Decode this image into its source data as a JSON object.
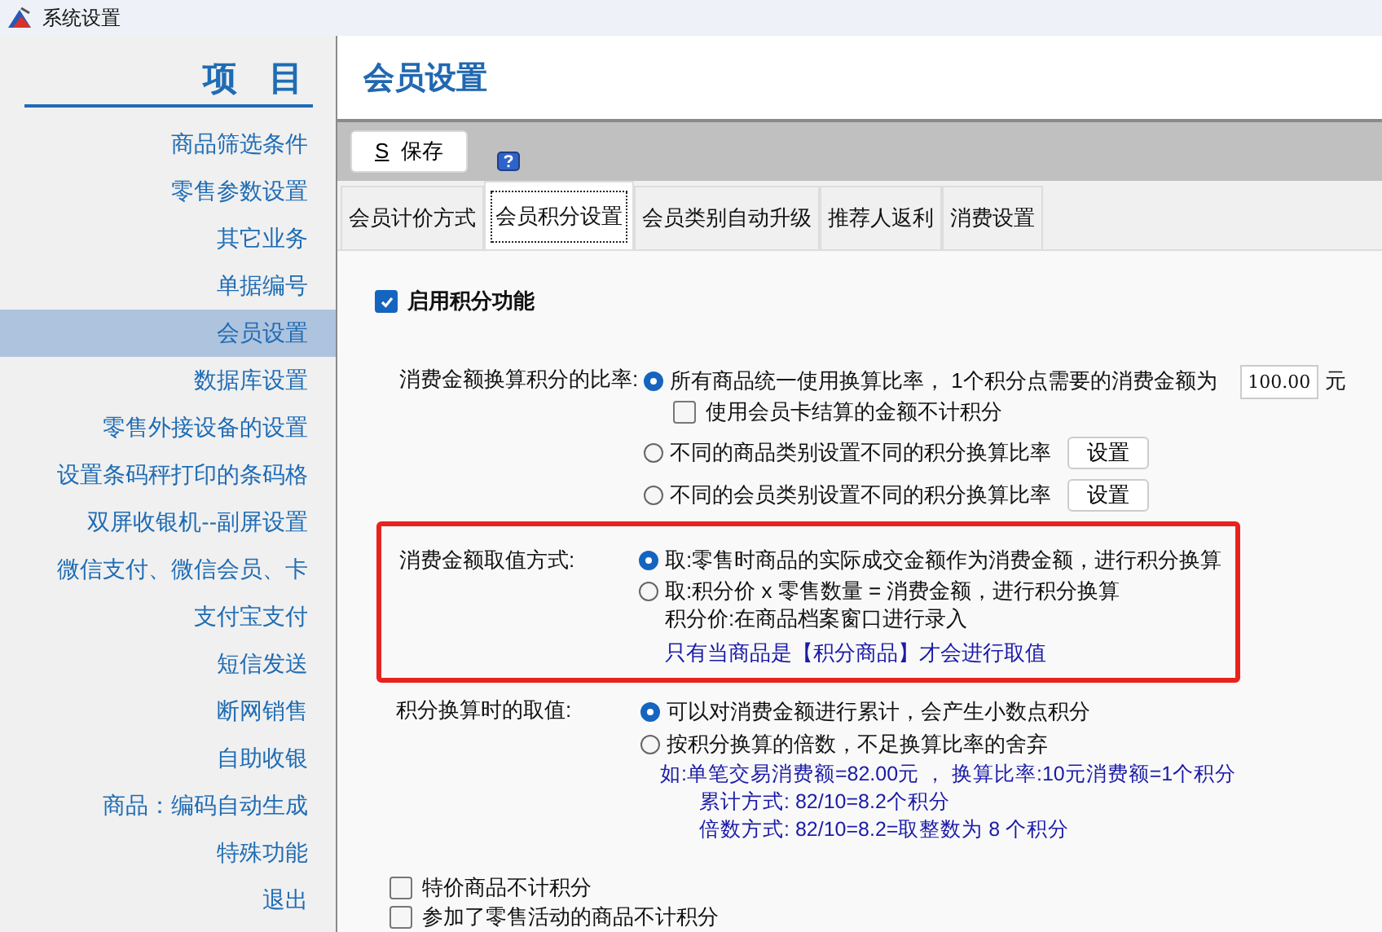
{
  "window": {
    "title": "系统设置"
  },
  "sidebar": {
    "heading": "项 目",
    "items": [
      {
        "label": "商品筛选条件",
        "selected": false
      },
      {
        "label": "零售参数设置",
        "selected": false
      },
      {
        "label": "其它业务",
        "selected": false
      },
      {
        "label": "单据编号",
        "selected": false
      },
      {
        "label": "会员设置",
        "selected": true
      },
      {
        "label": "数据库设置",
        "selected": false
      },
      {
        "label": "零售外接设备的设置",
        "selected": false
      },
      {
        "label": "设置条码秤打印的条码格",
        "selected": false
      },
      {
        "label": "双屏收银机--副屏设置",
        "selected": false
      },
      {
        "label": "微信支付、微信会员、卡",
        "selected": false
      },
      {
        "label": "支付宝支付",
        "selected": false
      },
      {
        "label": "短信发送",
        "selected": false
      },
      {
        "label": "断网销售",
        "selected": false
      },
      {
        "label": "自助收银",
        "selected": false
      },
      {
        "label": "商品：编码自动生成",
        "selected": false
      },
      {
        "label": "特殊功能",
        "selected": false
      },
      {
        "label": "退出",
        "selected": false
      }
    ]
  },
  "page_title": "会员设置",
  "toolbar": {
    "save_button": {
      "shortcut": "S",
      "label": "保存"
    }
  },
  "tabs": [
    {
      "label": "会员计价方式",
      "selected": false
    },
    {
      "label": "会员积分设置",
      "selected": true
    },
    {
      "label": "会员类别自动升级",
      "selected": false
    },
    {
      "label": "推荐人返利",
      "selected": false
    },
    {
      "label": "消费设置",
      "selected": false
    }
  ],
  "enable_points": {
    "label": "启用积分功能",
    "checked": true
  },
  "ratio": {
    "label": "消费金额换算积分的比率:",
    "options": [
      {
        "kind": "amount",
        "label": "所有商品统一使用换算比率， 1个积分点需要的消费金额为",
        "selected": true,
        "value": "100.00",
        "unit": "元",
        "sub_checkbox": {
          "label": "使用会员卡结算的金额不计积分",
          "checked": false
        }
      },
      {
        "kind": "button",
        "label": "不同的商品类别设置不同的积分换算比率",
        "selected": false,
        "button": "设置"
      },
      {
        "kind": "button",
        "label": "不同的会员类别设置不同的积分换算比率",
        "selected": false,
        "button": "设置"
      }
    ]
  },
  "value_mode": {
    "label": "消费金额取值方式:",
    "highlighted": true,
    "options": [
      {
        "lines": [
          "取:零售时商品的实际成交金额作为消费金额，进行积分换算"
        ],
        "selected": true
      },
      {
        "lines": [
          "取:积分价 x 零售数量 = 消费金额，进行积分换算",
          "积分价:在商品档案窗口进行录入"
        ],
        "selected": false
      }
    ],
    "note": "只有当商品是【积分商品】才会进行取值"
  },
  "rounding": {
    "label": "积分换算时的取值:",
    "options": [
      {
        "label": "可以对消费金额进行累计，会产生小数点积分",
        "selected": true
      },
      {
        "label": "按积分换算的倍数，不足换算比率的舍弃",
        "selected": false
      }
    ],
    "example": {
      "intro": "如:单笔交易消费额=82.00元 ，  换算比率:10元消费额=1个积分",
      "details": [
        "累计方式: 82/10=8.2个积分",
        "倍数方式: 82/10=8.2=取整数为 8 个积分"
      ]
    }
  },
  "footer_checkboxes": [
    {
      "label": "特价商品不计积分",
      "checked": false
    },
    {
      "label": "参加了零售活动的商品不计积分",
      "checked": false
    }
  ]
}
